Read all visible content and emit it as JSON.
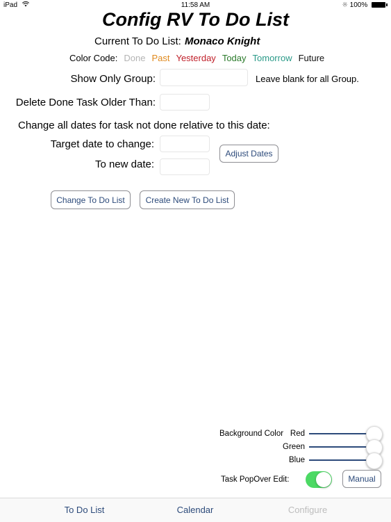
{
  "status_bar": {
    "device": "iPad",
    "time": "11:58 AM",
    "battery": "100%"
  },
  "header": {
    "title": "Config RV To Do List",
    "current_list_label": "Current To Do List:",
    "current_list_value": "Monaco Knight"
  },
  "color_code": {
    "label": "Color Code:",
    "items": [
      {
        "label": "Done",
        "color": "#b4b4b4"
      },
      {
        "label": "Past",
        "color": "#e08a1e"
      },
      {
        "label": "Yesterday",
        "color": "#c0202a"
      },
      {
        "label": "Today",
        "color": "#2a7a2a"
      },
      {
        "label": "Tomorrow",
        "color": "#2a9a88"
      },
      {
        "label": "Future",
        "color": "#111111"
      }
    ]
  },
  "form": {
    "group_label": "Show Only Group:",
    "group_value": "",
    "group_hint": "Leave blank for all Group.",
    "delete_label": "Delete Done Task Older Than:",
    "delete_value": "",
    "change_dates_text": "Change all dates for task not done relative to this date:",
    "target_label": "Target date to change:",
    "target_value": "",
    "new_date_label": "To new date:",
    "new_date_value": "",
    "adjust_button": "Adjust Dates",
    "change_list_button": "Change To Do List",
    "create_list_button": "Create New To Do List"
  },
  "settings": {
    "background_label": "Background Color",
    "sliders": [
      {
        "label": "Red",
        "value": 1.0
      },
      {
        "label": "Green",
        "value": 1.0
      },
      {
        "label": "Blue",
        "value": 1.0
      }
    ],
    "popover_label": "Task PopOver Edit:",
    "popover_on": true,
    "manual_button": "Manual"
  },
  "tabs": [
    {
      "label": "To Do List",
      "active": false
    },
    {
      "label": "Calendar",
      "active": false
    },
    {
      "label": "Configure",
      "active": true
    }
  ]
}
